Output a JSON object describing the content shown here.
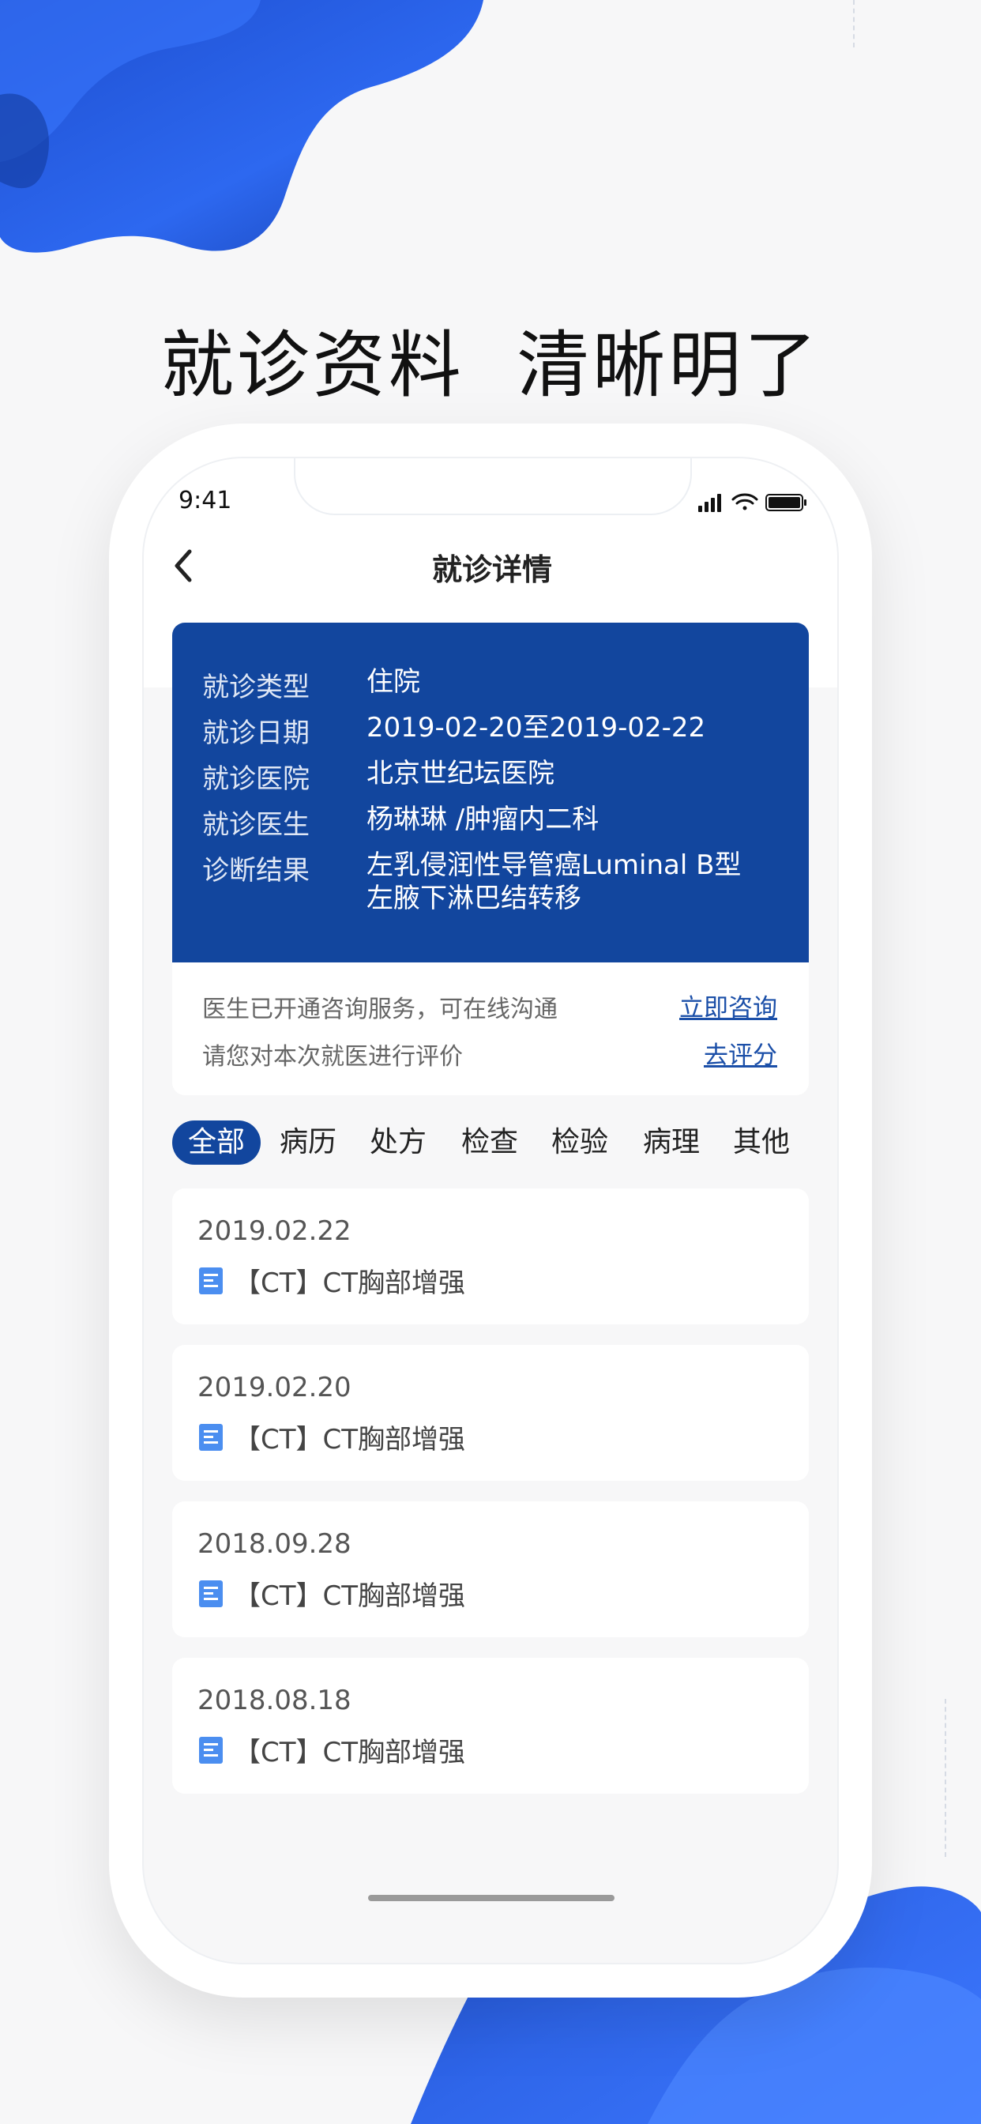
{
  "headline": "就诊资料  清晰明了",
  "status": {
    "time": "9:41"
  },
  "nav": {
    "title": "就诊详情",
    "back_icon": "chevron-left-icon"
  },
  "info": [
    {
      "label": "就诊类型",
      "value": "住院"
    },
    {
      "label": "就诊日期",
      "value": "2019-02-20至2019-02-22"
    },
    {
      "label": "就诊医院",
      "value": "北京世纪坛医院"
    },
    {
      "label": "就诊医生",
      "value": "杨琳琳 /肿瘤内二科"
    },
    {
      "label": "诊断结果",
      "value": "左乳侵润性导管癌Luminal B型",
      "value2": "左腋下淋巴结转移"
    }
  ],
  "consult": {
    "line1": "医生已开通咨询服务，可在线沟通",
    "link1": "立即咨询",
    "line2": "请您对本次就医进行评价",
    "link2": "去评分"
  },
  "tabs": [
    "全部",
    "病历",
    "处方",
    "检查",
    "检验",
    "病理",
    "其他"
  ],
  "records": [
    {
      "date": "2019.02.22",
      "title": "【CT】CT胸部增强"
    },
    {
      "date": "2019.02.20",
      "title": "【CT】CT胸部增强"
    },
    {
      "date": "2018.09.28",
      "title": "【CT】CT胸部增强"
    },
    {
      "date": "2018.08.18",
      "title": "【CT】CT胸部增强"
    }
  ],
  "colors": {
    "primary": "#12469e",
    "accent_blob": "#2f66ea",
    "link": "#1b4fa8",
    "doc_icon": "#4b8ef0"
  }
}
